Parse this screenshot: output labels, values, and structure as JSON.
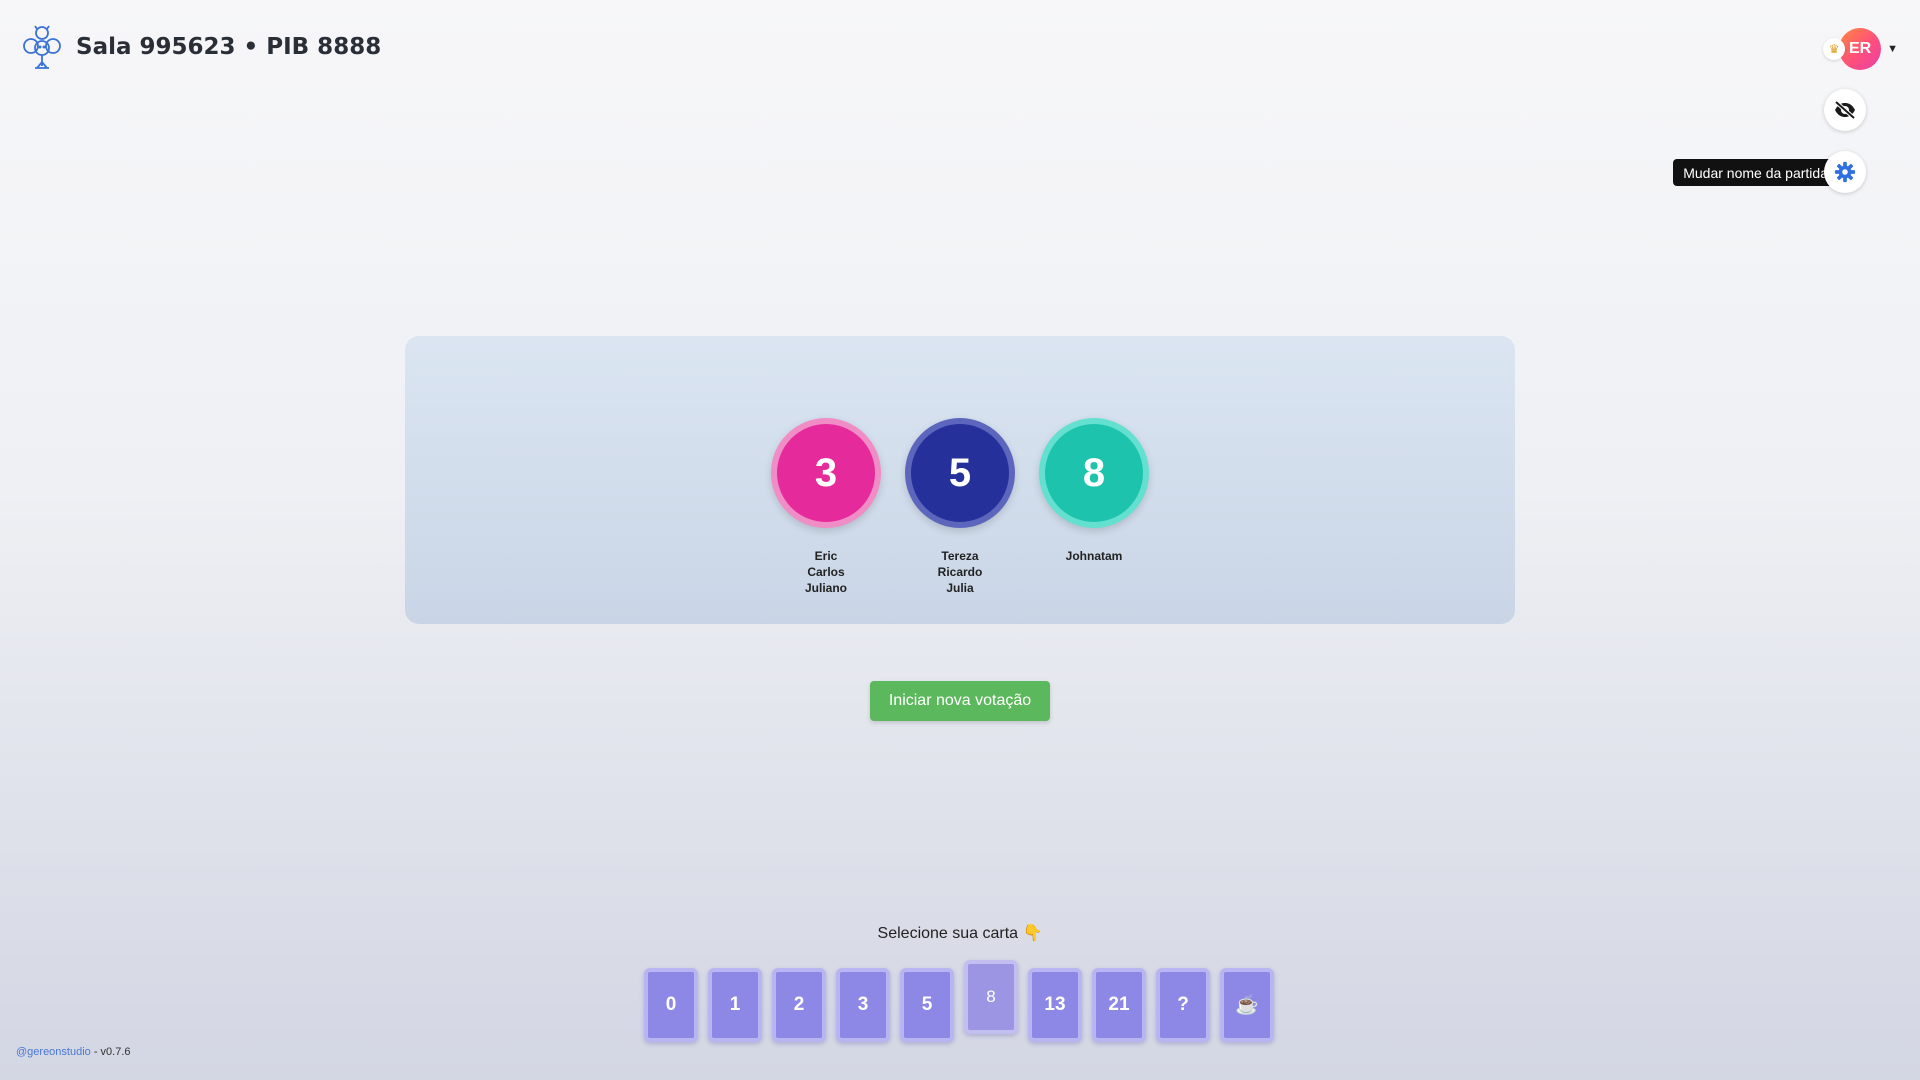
{
  "header": {
    "title": "Sala 995623 • PIB 8888",
    "logo_icon": "clover-robot-icon"
  },
  "user": {
    "initials": "ER",
    "crown_icon": "crown-icon",
    "menu_icon": "caret-down-icon"
  },
  "controls": {
    "hide_icon": "eye-off-icon",
    "settings_icon": "gear-icon",
    "settings_tooltip": "Mudar nome da partida"
  },
  "results": {
    "groups": [
      {
        "value": "3",
        "color": "#e52b9c",
        "ring": "#f08cc6",
        "names": [
          "Eric",
          "Carlos",
          "Juliano"
        ]
      },
      {
        "value": "5",
        "color": "#25309a",
        "ring": "#5d66bd",
        "names": [
          "Tereza",
          "Ricardo",
          "Julia"
        ]
      },
      {
        "value": "8",
        "color": "#1ec3ad",
        "ring": "#63e0cf",
        "names": [
          "Johnatam"
        ]
      }
    ]
  },
  "actions": {
    "new_vote_label": "Iniciar nova votação"
  },
  "deck": {
    "prompt": "Selecione sua carta 👇",
    "cards": [
      "0",
      "1",
      "2",
      "3",
      "5",
      "8",
      "13",
      "21",
      "?",
      "☕"
    ],
    "selected": "8"
  },
  "footer": {
    "link_text": "@gereonstudio",
    "version_text": " - v0.7.6"
  }
}
